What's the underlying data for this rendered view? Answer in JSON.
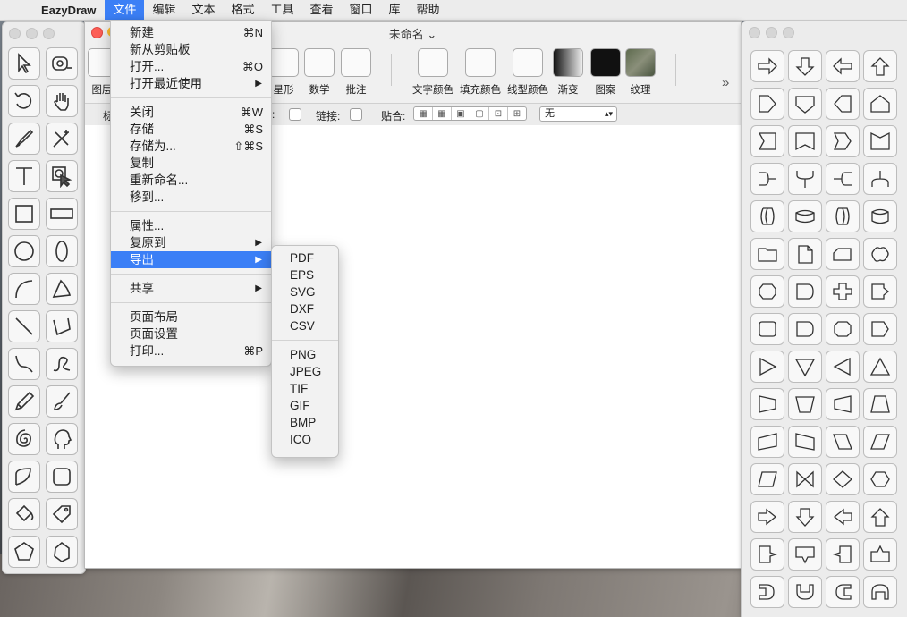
{
  "menubar": {
    "apple": "",
    "app_name": "EazyDraw",
    "items": [
      "文件",
      "编辑",
      "文本",
      "格式",
      "工具",
      "查看",
      "窗口",
      "库",
      "帮助"
    ]
  },
  "document": {
    "title": "未命名 ⌄",
    "toolbar_partial_left": "图层",
    "toolbar": [
      "星形",
      "数学",
      "批注",
      "文字颜色",
      "填充颜色",
      "线型颜色",
      "渐变",
      "图案",
      "纹理"
    ],
    "more": "»",
    "format_bar": {
      "label_left": "标",
      "link_label": "链接:",
      "snap_label": "贴合:",
      "select_value": "无"
    }
  },
  "file_menu": {
    "items": [
      {
        "label": "新建",
        "shortcut": "⌘N"
      },
      {
        "label": "新从剪贴板",
        "shortcut": ""
      },
      {
        "label": "打开...",
        "shortcut": "⌘O"
      },
      {
        "label": "打开最近使用",
        "shortcut": "▶"
      },
      {
        "label": "关闭",
        "shortcut": "⌘W"
      },
      {
        "label": "存储",
        "shortcut": "⌘S"
      },
      {
        "label": "存储为...",
        "shortcut": "⇧⌘S"
      },
      {
        "label": "复制",
        "shortcut": ""
      },
      {
        "label": "重新命名...",
        "shortcut": ""
      },
      {
        "label": "移到...",
        "shortcut": ""
      },
      {
        "label": "属性...",
        "shortcut": ""
      },
      {
        "label": "复原到",
        "shortcut": "▶"
      },
      {
        "label": "导出",
        "shortcut": "▶"
      },
      {
        "label": "共享",
        "shortcut": "▶"
      },
      {
        "label": "页面布局",
        "shortcut": ""
      },
      {
        "label": "页面设置",
        "shortcut": ""
      },
      {
        "label": "打印...",
        "shortcut": "⌘P"
      }
    ]
  },
  "export_menu": {
    "items": [
      "PDF",
      "EPS",
      "SVG",
      "DXF",
      "CSV",
      "PNG",
      "JPEG",
      "TIF",
      "GIF",
      "BMP",
      "ICO"
    ]
  },
  "colors": {
    "highlight": "#3b7ff6",
    "close": "#fd5f57",
    "minimize": "#fcbc2e"
  }
}
